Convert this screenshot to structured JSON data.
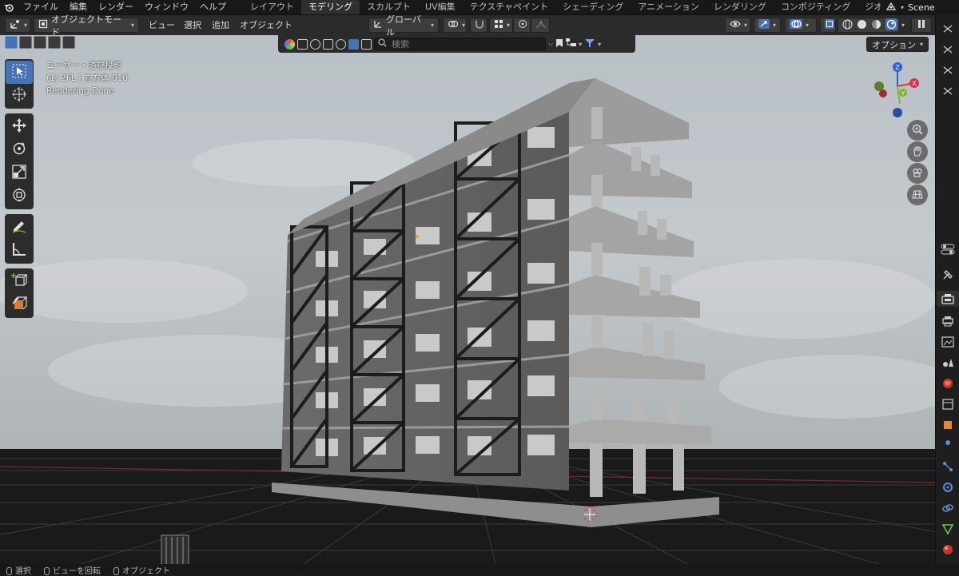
{
  "topbar": {
    "menus": [
      "ファイル",
      "編集",
      "レンダー",
      "ウィンドウ",
      "ヘルプ"
    ],
    "workspaces": [
      "レイアウト",
      "モデリング",
      "スカルプト",
      "UV編集",
      "テクスチャペイント",
      "シェーディング",
      "アニメーション",
      "レンダリング",
      "コンポジティング",
      "ジオメトリ"
    ],
    "active_workspace": "モデリング",
    "scene": "Scene"
  },
  "header": {
    "mode": "オブジェクトモード",
    "menus": [
      "ビュー",
      "選択",
      "追加",
      "オブジェクト"
    ],
    "transform_orientation": "グローバル"
  },
  "filter": {
    "search_placeholder": "検索"
  },
  "options_label": "オプション",
  "viewport": {
    "view_name": "ユーザー・透視投影",
    "object_info": "(1) 2FL | 立方体.010",
    "render_status": "Rendering Done",
    "gizmo": {
      "z": "Z",
      "x": "X",
      "y": "Y"
    }
  },
  "toolbar": {
    "tools": [
      "select-box",
      "cursor",
      "move",
      "rotate",
      "scale",
      "transform",
      "annotate",
      "measure",
      "add-cube",
      "transform-add"
    ],
    "active": "select-box"
  },
  "status": {
    "items": [
      "選択",
      "ビューを回転",
      "オブジェクト"
    ]
  },
  "colors": {
    "accent": "#4772b3",
    "background": "#1d1d1d",
    "header": "#2b2b2b"
  }
}
